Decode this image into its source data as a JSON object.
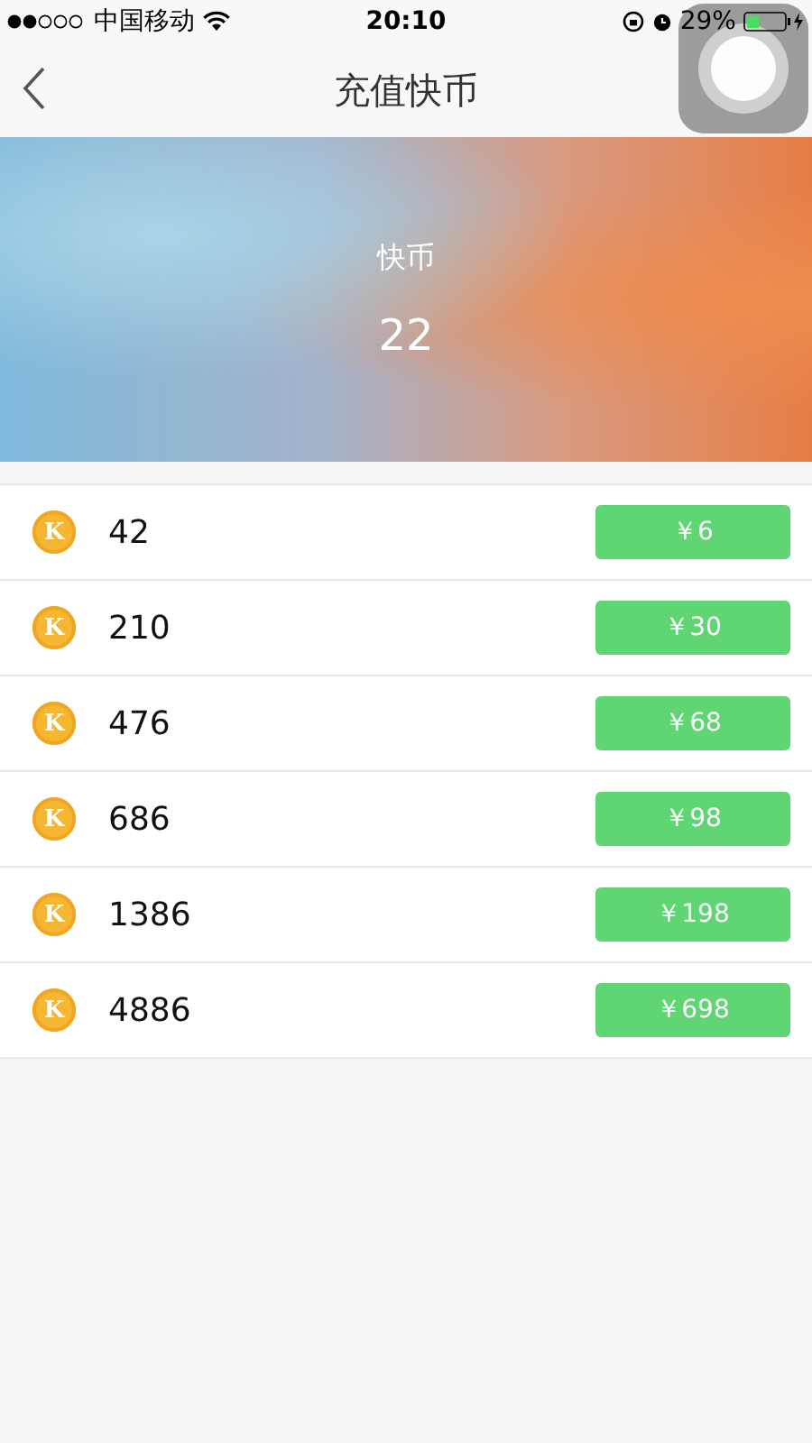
{
  "status_bar": {
    "carrier": "中国移动",
    "time": "20:10",
    "battery": "29%"
  },
  "nav": {
    "title": "充值快币"
  },
  "balance": {
    "label": "快币",
    "value": "22"
  },
  "packages": [
    {
      "coin_letter": "K",
      "amount": "42",
      "price": "￥6"
    },
    {
      "coin_letter": "K",
      "amount": "210",
      "price": "￥30"
    },
    {
      "coin_letter": "K",
      "amount": "476",
      "price": "￥68"
    },
    {
      "coin_letter": "K",
      "amount": "686",
      "price": "￥98"
    },
    {
      "coin_letter": "K",
      "amount": "1386",
      "price": "￥198"
    },
    {
      "coin_letter": "K",
      "amount": "4886",
      "price": "￥698"
    }
  ]
}
